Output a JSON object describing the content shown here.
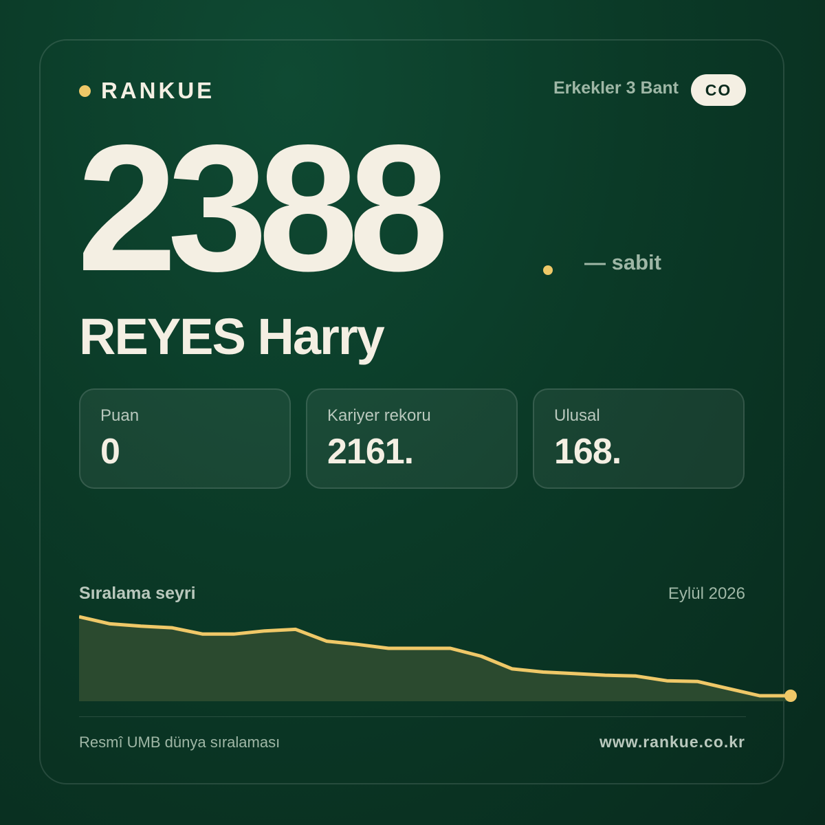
{
  "brand": {
    "name": "RANKUE",
    "accent_color": "#efc868"
  },
  "category": {
    "label": "Erkekler 3 Bant",
    "country_code": "CO"
  },
  "ranking": {
    "world_rank": "2388",
    "rank_suffix_dot": ".",
    "trend": "— sabit"
  },
  "player": {
    "name": "REYES Harry"
  },
  "stats": [
    {
      "label": "Puan",
      "value": "0"
    },
    {
      "label": "Kariyer rekoru",
      "value": "2161."
    },
    {
      "label": "Ulusal",
      "value": "168."
    }
  ],
  "chart": {
    "title": "Sıralama seyri",
    "date": "Eylül 2026"
  },
  "chart_data": {
    "type": "area",
    "values": [
      0.0,
      0.09,
      0.12,
      0.14,
      0.22,
      0.22,
      0.18,
      0.16,
      0.31,
      0.35,
      0.4,
      0.4,
      0.4,
      0.5,
      0.66,
      0.7,
      0.72,
      0.74,
      0.75,
      0.81,
      0.82,
      0.91,
      1.0,
      1.0
    ],
    "note_scale": "relative rank trend, 0 = top of visible range, 1 = bottom",
    "line_color": "#efc868",
    "fill_color": "#2b4a2f"
  },
  "footer": {
    "source": "Resmî UMB dünya sıralaması",
    "url": "www.rankue.co.kr"
  }
}
